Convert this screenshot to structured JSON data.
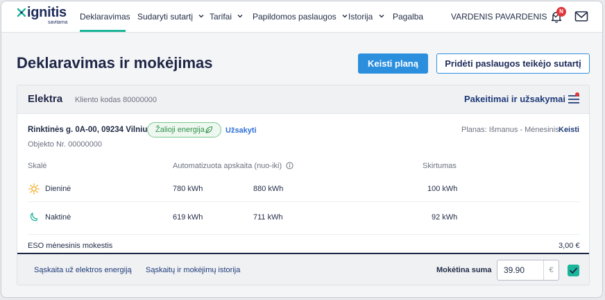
{
  "nav": {
    "logo": {
      "name": "ignitis",
      "sub": "savitarna"
    },
    "items": [
      {
        "label": "Deklaravimas",
        "dropdown": false
      },
      {
        "label": "Sudaryti sutartį",
        "dropdown": true
      },
      {
        "label": "Tarifai",
        "dropdown": true
      },
      {
        "label": "Papildomos paslaugos",
        "dropdown": true
      },
      {
        "label": "Istorija",
        "dropdown": true
      },
      {
        "label": "Pagalba",
        "dropdown": false
      }
    ],
    "active_index": 0,
    "user_name": "VARDENIS PAVARDENIS",
    "notification_badge": "N",
    "icons": {
      "bell": "bell-icon",
      "mail": "mail-icon"
    }
  },
  "header": {
    "title": "Deklaravimas ir mokėjimas",
    "primary_button": "Keisti planą",
    "secondary_button": "Pridėti paslaugos teikėjo sutartį"
  },
  "card": {
    "title": "Elektra",
    "client_code": "Kliento kodas 80000000",
    "changes_link": "Pakeitimai ir užsakymai",
    "address": "Rinktinės g. 0A-00, 09234 Vilnius",
    "green_badge": "Žalioji energija",
    "order_link": "Užsakyti",
    "object_no": "Objekto Nr. 00000000",
    "plan_label": "Planas: Išmanus - Mėnesinis",
    "change_link": "Keisti",
    "columns": {
      "scale": "Skalė",
      "auto": "Automatizuota apskaita (nuo-iki)",
      "diff": "Skirtumas"
    },
    "rows": [
      {
        "icon": "sun-icon",
        "label": "Dieninė",
        "from": "780 kWh",
        "to": "880 kWh",
        "diff": "100 kWh"
      },
      {
        "icon": "moon-icon",
        "label": "Naktinė",
        "from": "619 kWh",
        "to": "711 kWh",
        "diff": "92 kWh"
      }
    ],
    "eso_label": "ESO mėnesinis mokestis",
    "eso_value": "3,00 €",
    "footer": {
      "invoice_link": "Sąskaita už elektros energiją",
      "history_link": "Sąskaitų ir mokėjimų istorija",
      "sum_label": "Mokėtina suma",
      "sum_value": "39.90",
      "currency": "€",
      "checkbox_checked": true
    }
  },
  "colors": {
    "accent_teal": "#1bb59a",
    "primary_blue": "#2c8fde",
    "navy": "#1d2545",
    "badge_red": "#e0363b",
    "green": "#2f8f4a"
  }
}
